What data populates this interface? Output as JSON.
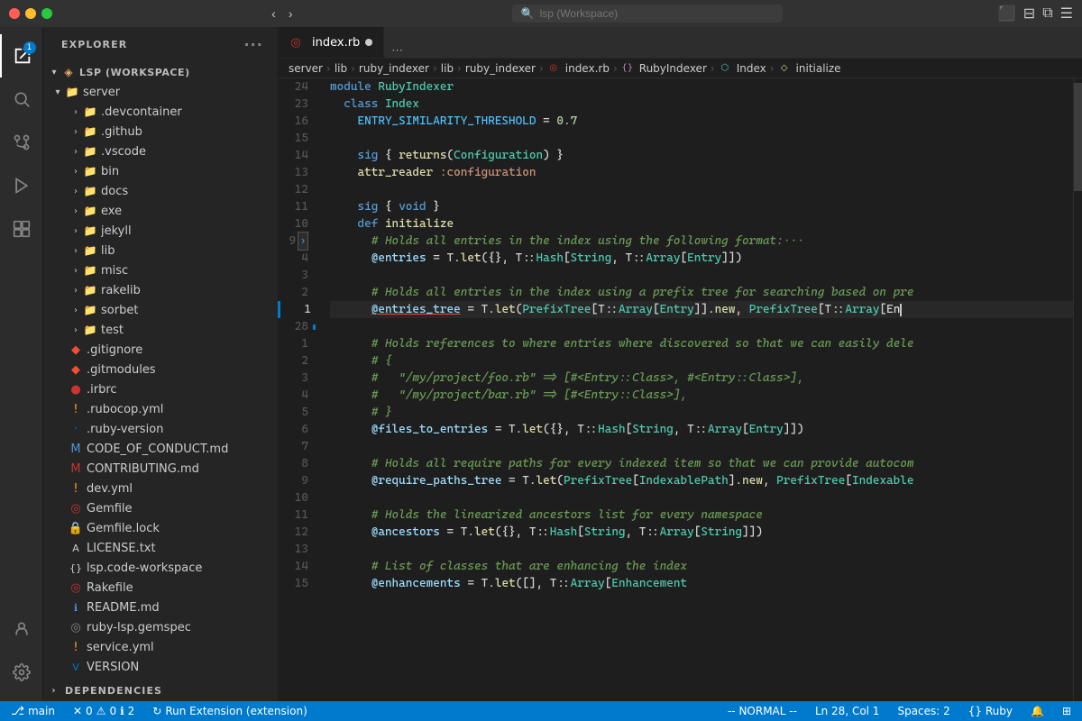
{
  "titlebar": {
    "search_placeholder": "lsp (Workspace)",
    "nav_back": "‹",
    "nav_forward": "›"
  },
  "sidebar": {
    "title": "EXPLORER",
    "workspace_label": "LSP (WORKSPACE)",
    "deps_label": "DEPENDENCIES",
    "dots_label": "···"
  },
  "tabs": [
    {
      "label": "index.rb",
      "active": true,
      "modified": true,
      "icon": "ruby"
    }
  ],
  "breadcrumb": [
    {
      "label": "server",
      "type": "folder"
    },
    {
      "label": "lib",
      "type": "folder"
    },
    {
      "label": "ruby_indexer",
      "type": "folder"
    },
    {
      "label": "lib",
      "type": "folder"
    },
    {
      "label": "ruby_indexer",
      "type": "folder"
    },
    {
      "label": "index.rb",
      "type": "file-ruby"
    },
    {
      "label": "RubyIndexer",
      "type": "module"
    },
    {
      "label": "Index",
      "type": "class"
    },
    {
      "label": "initialize",
      "type": "method"
    }
  ],
  "file_tree": [
    {
      "indent": 0,
      "type": "folder-open",
      "label": "server",
      "icon": "folder"
    },
    {
      "indent": 1,
      "type": "folder-closed",
      "label": ".devcontainer",
      "icon": "folder"
    },
    {
      "indent": 1,
      "type": "folder-closed",
      "label": ".github",
      "icon": "folder"
    },
    {
      "indent": 1,
      "type": "folder-closed",
      "label": ".vscode",
      "icon": "folder"
    },
    {
      "indent": 1,
      "type": "folder-closed",
      "label": "bin",
      "icon": "folder"
    },
    {
      "indent": 1,
      "type": "folder-closed",
      "label": "docs",
      "icon": "folder"
    },
    {
      "indent": 1,
      "type": "folder-closed",
      "label": "exe",
      "icon": "folder"
    },
    {
      "indent": 1,
      "type": "folder-closed",
      "label": "jekyll",
      "icon": "folder"
    },
    {
      "indent": 1,
      "type": "folder-closed",
      "label": "lib",
      "icon": "folder"
    },
    {
      "indent": 1,
      "type": "folder-closed",
      "label": "misc",
      "icon": "folder"
    },
    {
      "indent": 1,
      "type": "folder-closed",
      "label": "rakelib",
      "icon": "folder"
    },
    {
      "indent": 1,
      "type": "folder-closed",
      "label": "sorbet",
      "icon": "folder"
    },
    {
      "indent": 1,
      "type": "folder-closed",
      "label": "test",
      "icon": "folder"
    },
    {
      "indent": 1,
      "type": "file",
      "label": ".gitignore",
      "icon": "git"
    },
    {
      "indent": 1,
      "type": "file",
      "label": ".gitmodules",
      "icon": "git"
    },
    {
      "indent": 1,
      "type": "file",
      "label": ".irbrc",
      "icon": "ruby-red"
    },
    {
      "indent": 1,
      "type": "file",
      "label": ".rubocop.yml",
      "icon": "yaml-excl"
    },
    {
      "indent": 1,
      "type": "file",
      "label": ".ruby-version",
      "icon": "ruby-dot"
    },
    {
      "indent": 1,
      "type": "file",
      "label": "CODE_OF_CONDUCT.md",
      "icon": "md"
    },
    {
      "indent": 1,
      "type": "file",
      "label": "CONTRIBUTING.md",
      "icon": "md-red"
    },
    {
      "indent": 1,
      "type": "file",
      "label": "dev.yml",
      "icon": "yaml-excl"
    },
    {
      "indent": 1,
      "type": "file",
      "label": "Gemfile",
      "icon": "gem"
    },
    {
      "indent": 1,
      "type": "file",
      "label": "Gemfile.lock",
      "icon": "lock"
    },
    {
      "indent": 1,
      "type": "file",
      "label": "LICENSE.txt",
      "icon": "txt"
    },
    {
      "indent": 1,
      "type": "file",
      "label": "lsp.code-workspace",
      "icon": "workspace"
    },
    {
      "indent": 1,
      "type": "file",
      "label": "Rakefile",
      "icon": "gem"
    },
    {
      "indent": 1,
      "type": "file",
      "label": "README.md",
      "icon": "info-md"
    },
    {
      "indent": 1,
      "type": "file",
      "label": "ruby-lsp.gemspec",
      "icon": "gem-gray"
    },
    {
      "indent": 1,
      "type": "file",
      "label": "service.yml",
      "icon": "yaml-excl"
    },
    {
      "indent": 1,
      "type": "file",
      "label": "VERSION",
      "icon": "version"
    }
  ],
  "code_lines": [
    {
      "num": "24",
      "tokens": [
        {
          "t": "kw",
          "v": "module "
        },
        {
          "t": "cn",
          "v": "RubyIndexer"
        }
      ]
    },
    {
      "num": "23",
      "tokens": [
        {
          "t": "kw",
          "v": "  class "
        },
        {
          "t": "cn",
          "v": "Index"
        }
      ]
    },
    {
      "num": "16",
      "tokens": [
        {
          "t": "plain",
          "v": "    "
        },
        {
          "t": "const",
          "v": "ENTRY_SIMILARITY_THRESHOLD"
        },
        {
          "t": "plain",
          "v": " = "
        },
        {
          "t": "num",
          "v": "0.7"
        }
      ]
    },
    {
      "num": "15",
      "tokens": []
    },
    {
      "num": "14",
      "tokens": [
        {
          "t": "plain",
          "v": "    "
        },
        {
          "t": "kw",
          "v": "sig"
        },
        {
          "t": "plain",
          "v": " { "
        },
        {
          "t": "fn",
          "v": "returns"
        },
        {
          "t": "plain",
          "v": "("
        },
        {
          "t": "cn",
          "v": "Configuration"
        },
        {
          "t": "plain",
          "v": ") }"
        }
      ]
    },
    {
      "num": "13",
      "tokens": [
        {
          "t": "plain",
          "v": "    "
        },
        {
          "t": "fn",
          "v": "attr_reader"
        },
        {
          "t": "plain",
          "v": " "
        },
        {
          "t": "sym",
          "v": ":configuration"
        }
      ]
    },
    {
      "num": "12",
      "tokens": []
    },
    {
      "num": "11",
      "tokens": [
        {
          "t": "plain",
          "v": "    "
        },
        {
          "t": "kw",
          "v": "sig"
        },
        {
          "t": "plain",
          "v": " { "
        },
        {
          "t": "kw",
          "v": "void"
        },
        {
          "t": "plain",
          "v": " }"
        }
      ]
    },
    {
      "num": "10",
      "tokens": [
        {
          "t": "plain",
          "v": "    "
        },
        {
          "t": "kw",
          "v": "def "
        },
        {
          "t": "fn",
          "v": "initialize"
        }
      ]
    },
    {
      "num": "9",
      "tokens": [
        {
          "t": "plain",
          "v": "      "
        },
        {
          "t": "cmt",
          "v": "# Holds all entries in the index using the following format:···"
        }
      ],
      "folded": true
    },
    {
      "num": "4",
      "tokens": [
        {
          "t": "plain",
          "v": "      "
        },
        {
          "t": "ivar",
          "v": "@entries"
        },
        {
          "t": "plain",
          "v": " = "
        },
        {
          "t": "plain",
          "v": "T."
        },
        {
          "t": "fn",
          "v": "let"
        },
        {
          "t": "plain",
          "v": "({}, T::"
        },
        {
          "t": "cn",
          "v": "Hash"
        },
        {
          "t": "plain",
          "v": "["
        },
        {
          "t": "cn",
          "v": "String"
        },
        {
          "t": "plain",
          "v": ", T::"
        },
        {
          "t": "cn",
          "v": "Array"
        },
        {
          "t": "plain",
          "v": "["
        },
        {
          "t": "cn",
          "v": "Entry"
        },
        {
          "t": "plain",
          "v": "]])"
        }
      ]
    },
    {
      "num": "3",
      "tokens": []
    },
    {
      "num": "2",
      "tokens": [
        {
          "t": "plain",
          "v": "      "
        },
        {
          "t": "cmt",
          "v": "# Holds all entries in the index using a prefix tree for searching based on pre"
        }
      ]
    },
    {
      "num": "1",
      "tokens": [
        {
          "t": "plain",
          "v": "      "
        },
        {
          "t": "ivar",
          "v": "@entries_tree"
        },
        {
          "t": "plain",
          "v": " = T."
        },
        {
          "t": "fn",
          "v": "let"
        },
        {
          "t": "plain",
          "v": "("
        },
        {
          "t": "cn",
          "v": "PrefixTree"
        },
        {
          "t": "plain",
          "v": "[T::"
        },
        {
          "t": "cn",
          "v": "Array"
        },
        {
          "t": "plain",
          "v": "["
        },
        {
          "t": "cn",
          "v": "Entry"
        },
        {
          "t": "plain",
          "v": "]]."
        },
        {
          "t": "fn",
          "v": "new"
        },
        {
          "t": "plain",
          "v": ", "
        },
        {
          "t": "cn",
          "v": "PrefixTree"
        },
        {
          "t": "plain",
          "v": "[T::"
        },
        {
          "t": "cn",
          "v": "Array"
        },
        {
          "t": "plain",
          "v": "[En"
        }
      ],
      "current": true
    },
    {
      "num": "28",
      "tokens": []
    },
    {
      "num": "1",
      "tokens": [
        {
          "t": "plain",
          "v": "      "
        },
        {
          "t": "cmt",
          "v": "# Holds references to where entries where discovered so that we can easily dele"
        }
      ]
    },
    {
      "num": "2",
      "tokens": [
        {
          "t": "plain",
          "v": "      "
        },
        {
          "t": "cmt",
          "v": "# {"
        }
      ]
    },
    {
      "num": "3",
      "tokens": [
        {
          "t": "plain",
          "v": "      "
        },
        {
          "t": "cmt",
          "v": "#   \"/my/project/foo.rb\" => [#<Entry::Class>, #<Entry::Class>],"
        }
      ]
    },
    {
      "num": "4",
      "tokens": [
        {
          "t": "plain",
          "v": "      "
        },
        {
          "t": "cmt",
          "v": "#   \"/my/project/bar.rb\" => [#<Entry::Class>],"
        }
      ]
    },
    {
      "num": "5",
      "tokens": [
        {
          "t": "plain",
          "v": "      "
        },
        {
          "t": "cmt",
          "v": "# }"
        }
      ]
    },
    {
      "num": "6",
      "tokens": [
        {
          "t": "plain",
          "v": "      "
        },
        {
          "t": "ivar",
          "v": "@files_to_entries"
        },
        {
          "t": "plain",
          "v": " = T."
        },
        {
          "t": "fn",
          "v": "let"
        },
        {
          "t": "plain",
          "v": "({}, T::"
        },
        {
          "t": "cn",
          "v": "Hash"
        },
        {
          "t": "plain",
          "v": "["
        },
        {
          "t": "cn",
          "v": "String"
        },
        {
          "t": "plain",
          "v": ", T::"
        },
        {
          "t": "cn",
          "v": "Array"
        },
        {
          "t": "plain",
          "v": "["
        },
        {
          "t": "cn",
          "v": "Entry"
        },
        {
          "t": "plain",
          "v": "]])"
        }
      ]
    },
    {
      "num": "7",
      "tokens": []
    },
    {
      "num": "8",
      "tokens": [
        {
          "t": "plain",
          "v": "      "
        },
        {
          "t": "cmt",
          "v": "# Holds all require paths for every indexed item so that we can provide autocom"
        }
      ]
    },
    {
      "num": "9",
      "tokens": [
        {
          "t": "plain",
          "v": "      "
        },
        {
          "t": "ivar",
          "v": "@require_paths_tree"
        },
        {
          "t": "plain",
          "v": " = T."
        },
        {
          "t": "fn",
          "v": "let"
        },
        {
          "t": "plain",
          "v": "("
        },
        {
          "t": "cn",
          "v": "PrefixTree"
        },
        {
          "t": "plain",
          "v": "["
        },
        {
          "t": "cn",
          "v": "IndexablePath"
        },
        {
          "t": "plain",
          "v": "]."
        },
        {
          "t": "fn",
          "v": "new"
        },
        {
          "t": "plain",
          "v": ", "
        },
        {
          "t": "cn",
          "v": "PrefixTree"
        },
        {
          "t": "plain",
          "v": "["
        },
        {
          "t": "cn",
          "v": "Indexable"
        }
      ]
    },
    {
      "num": "10",
      "tokens": []
    },
    {
      "num": "11",
      "tokens": [
        {
          "t": "plain",
          "v": "      "
        },
        {
          "t": "cmt",
          "v": "# Holds the linearized ancestors list for every namespace"
        }
      ]
    },
    {
      "num": "12",
      "tokens": [
        {
          "t": "plain",
          "v": "      "
        },
        {
          "t": "ivar",
          "v": "@ancestors"
        },
        {
          "t": "plain",
          "v": " = T."
        },
        {
          "t": "fn",
          "v": "let"
        },
        {
          "t": "plain",
          "v": "({}, T::"
        },
        {
          "t": "cn",
          "v": "Hash"
        },
        {
          "t": "plain",
          "v": "["
        },
        {
          "t": "cn",
          "v": "String"
        },
        {
          "t": "plain",
          "v": ", T::"
        },
        {
          "t": "cn",
          "v": "Array"
        },
        {
          "t": "plain",
          "v": "["
        },
        {
          "t": "cn",
          "v": "String"
        },
        {
          "t": "plain",
          "v": "]])"
        }
      ]
    },
    {
      "num": "13",
      "tokens": []
    },
    {
      "num": "14",
      "tokens": [
        {
          "t": "plain",
          "v": "      "
        },
        {
          "t": "cmt",
          "v": "# List of classes that are enhancing the index"
        }
      ]
    },
    {
      "num": "15",
      "tokens": [
        {
          "t": "plain",
          "v": "      "
        },
        {
          "t": "ivar",
          "v": "@enhancements"
        },
        {
          "t": "plain",
          "v": " = T."
        },
        {
          "t": "fn",
          "v": "let"
        },
        {
          "t": "plain",
          "v": "([],  T::"
        },
        {
          "t": "cn",
          "v": "Array"
        },
        {
          "t": "plain",
          "v": "["
        },
        {
          "t": "cn",
          "v": "Enhancement"
        }
      ]
    }
  ],
  "statusbar": {
    "branch": "main",
    "errors": "0",
    "warnings": "0",
    "info": "2",
    "task": "Run Extension (extension)",
    "mode": "-- NORMAL --",
    "position": "Ln 28, Col 1",
    "spaces": "Spaces: 2",
    "encoding": "{}  Ruby",
    "bell_icon": "🔔",
    "layout_icon": "⊞"
  }
}
